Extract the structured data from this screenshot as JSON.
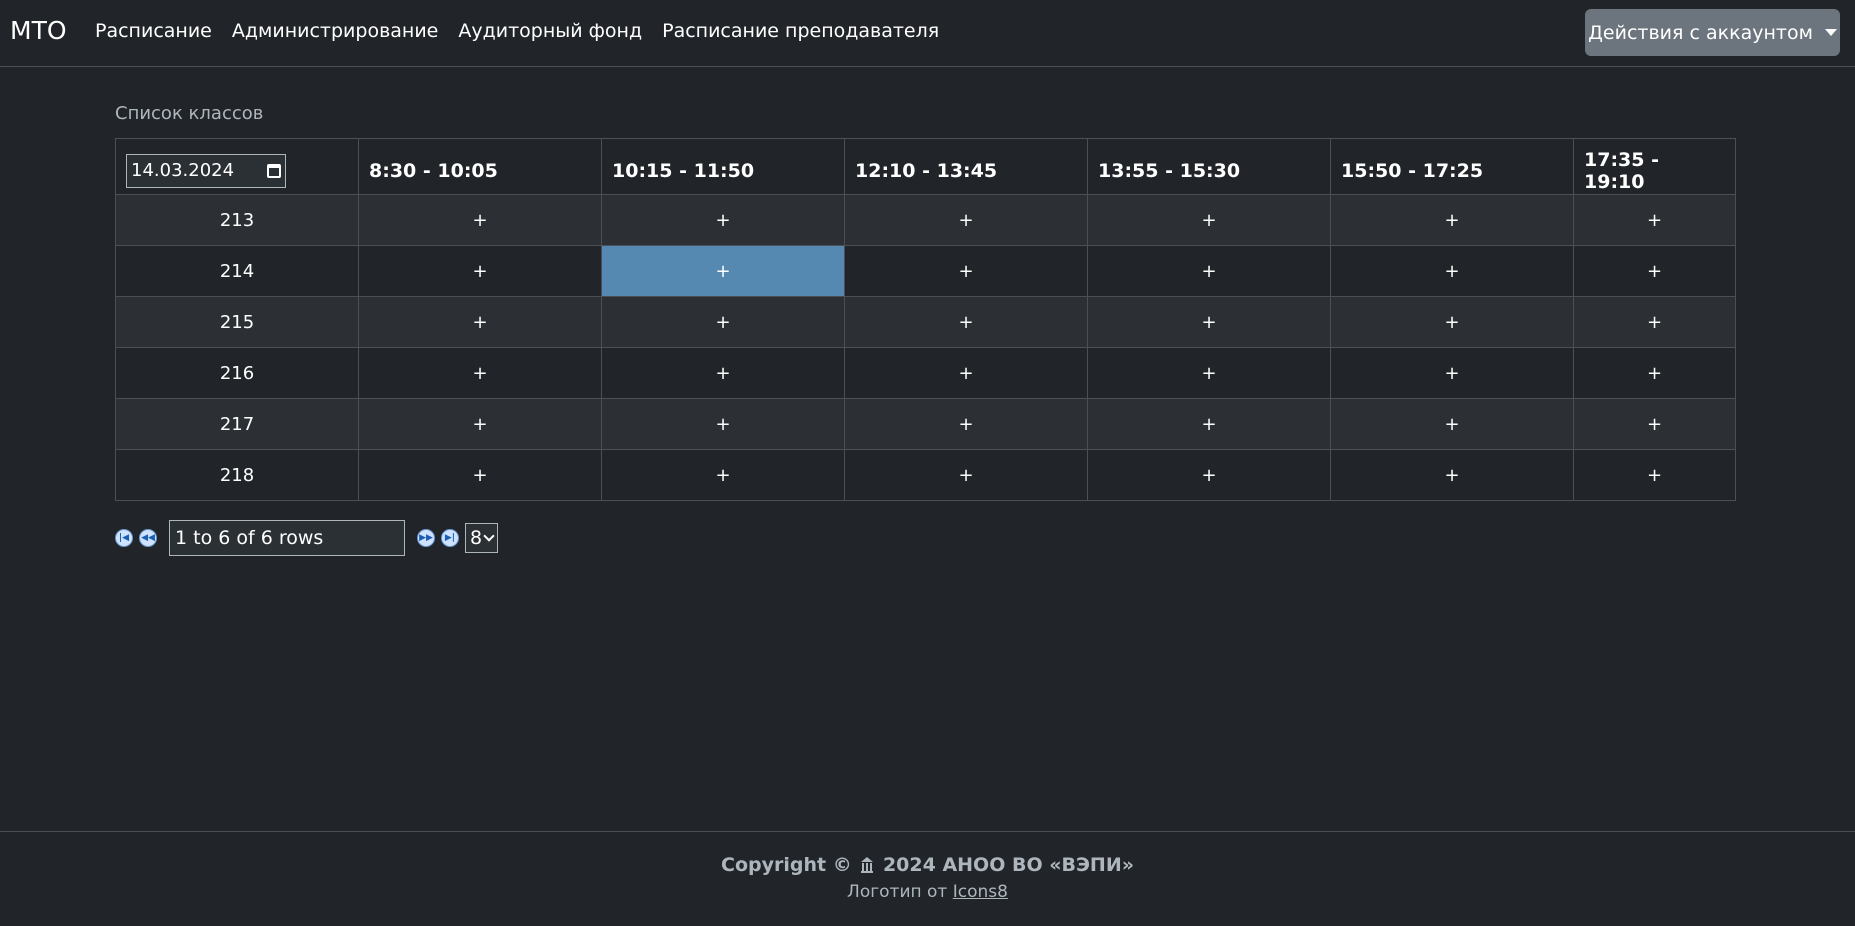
{
  "navbar": {
    "brand": "МТО",
    "links": [
      "Расписание",
      "Администрирование",
      "Аудиторный фонд",
      "Расписание преподавателя"
    ],
    "account_button": "Действия с аккаунтом"
  },
  "section_title": "Список классов",
  "table": {
    "date_value": "14.03.2024",
    "time_slots": [
      "8:30 - 10:05",
      "10:15 - 11:50",
      "12:10 - 13:45",
      "13:55 - 15:30",
      "15:50 - 17:25",
      "17:35 - 19:10"
    ],
    "rooms": [
      "213",
      "214",
      "215",
      "216",
      "217",
      "218"
    ],
    "cell_symbol": "+",
    "selected_cell": {
      "room": "214",
      "slot": "10:15 - 11:50"
    },
    "selected_color": "#5689b2"
  },
  "pager": {
    "info": "1 to 6 of 6 rows",
    "page_size": "8"
  },
  "footer": {
    "copyright_prefix": "Copyright ©",
    "copyright_suffix": "2024 АНОО ВО «ВЭПИ»",
    "logo_by": "Логотип от",
    "logo_link": "Icons8"
  },
  "colors": {
    "background": "#212529",
    "account_button": "#6c757d"
  }
}
